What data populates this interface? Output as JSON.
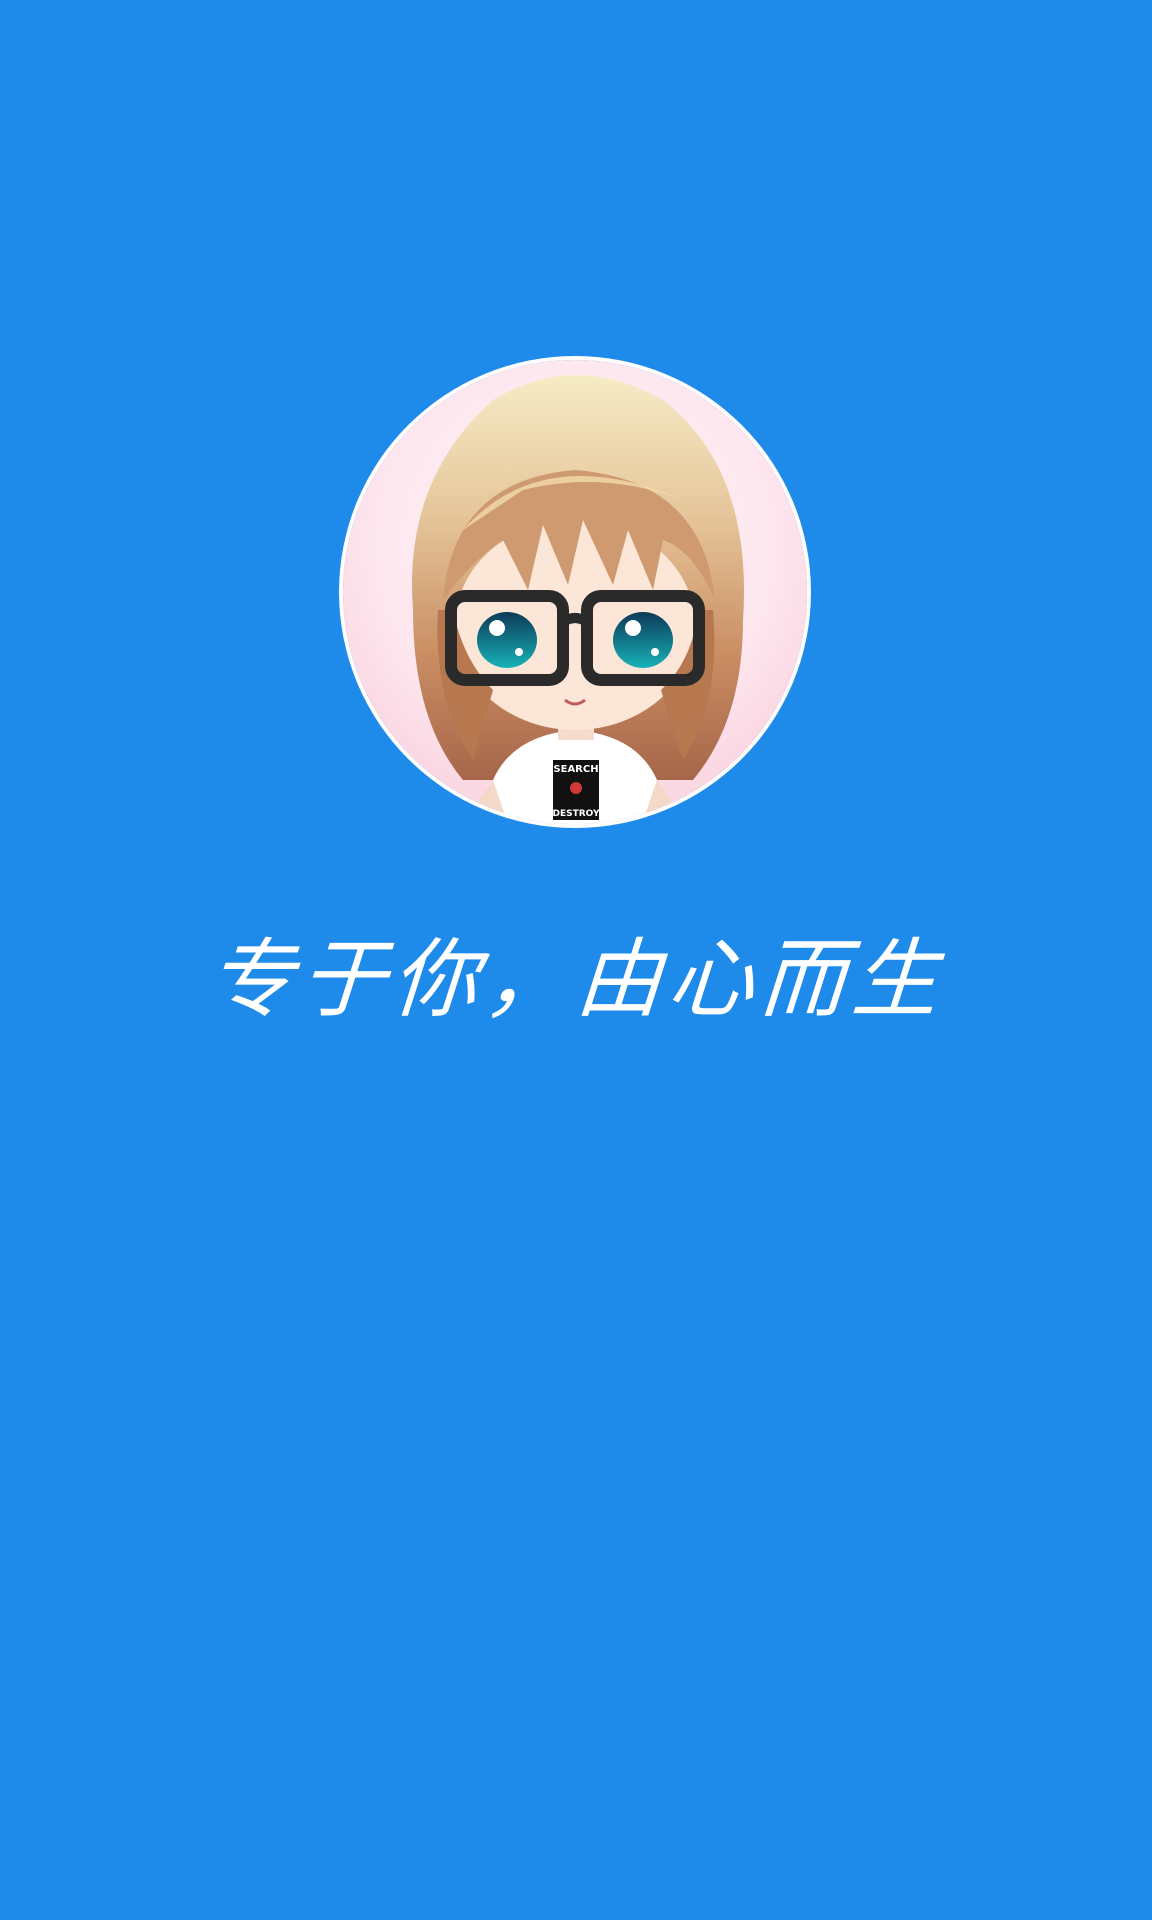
{
  "screen": {
    "background_color": "#1e8beb"
  },
  "avatar": {
    "icon": "anime-girl-with-glasses-avatar",
    "shirt_text": "SEARCH DESTROY"
  },
  "slogan": {
    "text": "专于你，由心而生",
    "color": "#ffffff"
  }
}
